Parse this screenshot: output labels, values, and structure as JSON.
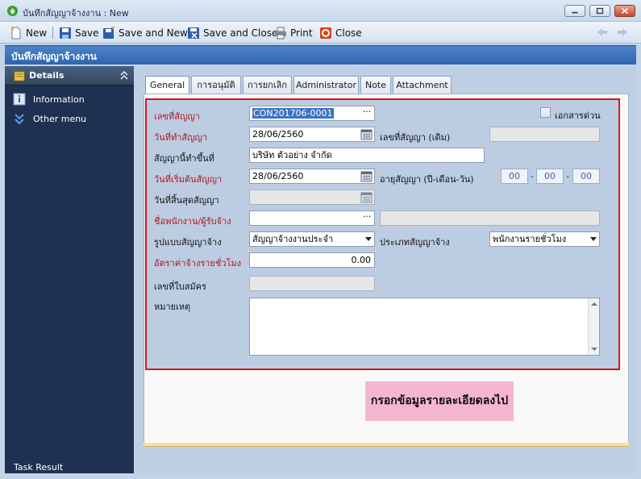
{
  "window": {
    "title": "บันทึกสัญญาจ้างงาน : New"
  },
  "toolbar": {
    "new_label": "New",
    "save_label": "Save",
    "save_new_label": "Save and New",
    "save_close_label": "Save and Close",
    "print_label": "Print",
    "close_label": "Close"
  },
  "header": {
    "title": "บันทึกสัญญาจ้างงาน"
  },
  "sidebar": {
    "section_title": "Details",
    "items": [
      {
        "label": "Information",
        "icon": "info-icon"
      },
      {
        "label": "Other menu",
        "icon": "double-chevron-down-icon"
      }
    ],
    "footer": "Task Result"
  },
  "tabs": [
    {
      "label": "General",
      "active": true
    },
    {
      "label": "การอนุมัติ",
      "active": false
    },
    {
      "label": "การยกเลิก",
      "active": false
    },
    {
      "label": "Administrator",
      "active": false
    },
    {
      "label": "Note",
      "active": false
    },
    {
      "label": "Attachment",
      "active": false
    }
  ],
  "form": {
    "contract_no_label": "เลขที่สัญญา",
    "contract_no_value": "CON201706-0001",
    "urgent_label": "เอกสารด่วน",
    "contract_date_label": "วันที่ทำสัญญา",
    "contract_date_value": "28/06/2560",
    "old_contract_no_label": "เลขที่สัญญา (เดิม)",
    "old_contract_no_value": "",
    "place_label": "สัญญานี้ทำขึ้นที่",
    "place_value": "บริษัท ตัวอย่าง จำกัด",
    "start_date_label": "วันที่เริ่มต้นสัญญา",
    "start_date_value": "28/06/2560",
    "duration_label": "อายุสัญญา (ปี-เดือน-วัน)",
    "duration_years": "00",
    "duration_months": "00",
    "duration_days": "00",
    "duration_separator": "-",
    "end_date_label": "วันที่สิ้นสุดสัญญา",
    "end_date_value": "",
    "employee_label": "ชื่อพนักงาน/ผู้รับจ้าง",
    "employee_value": "",
    "employee_name_value": "",
    "contract_form_label": "รูปแบบสัญญาจ้าง",
    "contract_form_value": "สัญญาจ้างงานประจำ",
    "contract_type_label": "ประเภทสัญญาจ้าง",
    "contract_type_value": "พนักงานรายชั่วโมง",
    "hourly_rate_label": "อัตราค่าจ้างรายชั่วโมง",
    "hourly_rate_value": "0.00",
    "application_no_label": "เลขที่ใบสมัคร",
    "application_no_value": "",
    "remark_label": "หมายเหตุ",
    "remark_value": "",
    "ellipsis": "···"
  },
  "annotation": {
    "text": "กรอกข้อมูลรายละเอียดลงไป"
  },
  "colors": {
    "header_blue": "#2e65ad",
    "sidebar_navy": "#1e3150",
    "required_label": "#b4141b",
    "highlight_border": "#d8141c",
    "annotation_pink": "#f4b6cf"
  }
}
